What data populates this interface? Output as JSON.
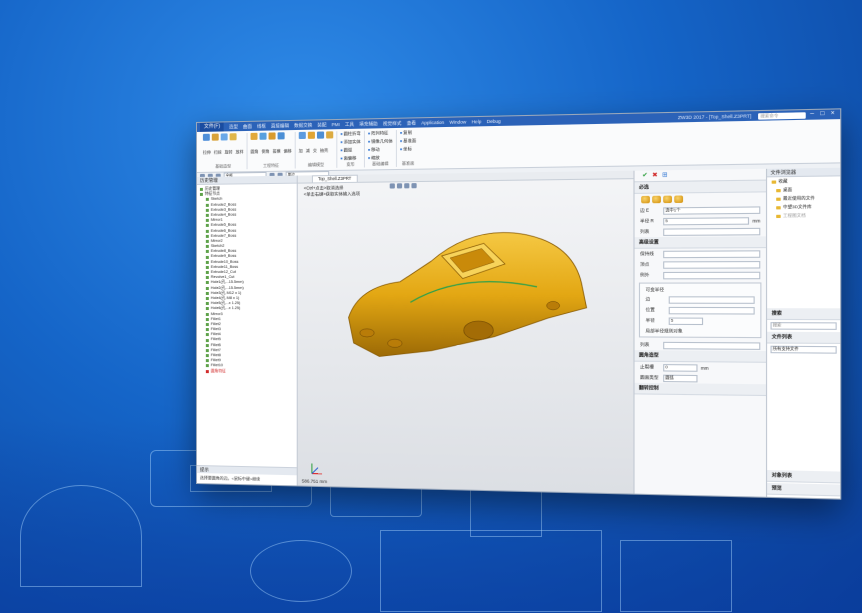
{
  "app": {
    "file_tab": "文件(F)",
    "menus": [
      "造型",
      "曲面",
      "线框",
      "直接编辑",
      "数据交换",
      "装配",
      "PMI",
      "工具",
      "填充辅助",
      "视觉样式",
      "查看",
      "Application",
      "Window",
      "Help",
      "Debug"
    ],
    "title": "ZW3D 2017 - [Top_Shell.Z3PRT]",
    "search_placeholder": "搜索命令",
    "win_buttons": [
      "–",
      "□",
      "×"
    ]
  },
  "ribbon": {
    "groups": [
      {
        "labels": [
          "拉伸",
          "扫掠",
          "旋转",
          "放样"
        ],
        "caption": "基础造型"
      },
      {
        "labels": [
          "圆角",
          "倒角",
          "拔模",
          "偏移"
        ],
        "caption": "工程特征"
      },
      {
        "labels": [
          "加",
          "减",
          "交",
          "抽壳"
        ],
        "caption": "编辑模型"
      },
      {
        "rows": [
          "圆柱折弯",
          "添加实体",
          "圆弧",
          "面偏移"
        ],
        "caption": "变形"
      },
      {
        "rows": [
          "阵列特征",
          "镜像几何体",
          "移动",
          "缩放"
        ],
        "caption": "基础编辑"
      },
      {
        "rows": [
          "复制",
          "基准面",
          "坐标"
        ],
        "caption": "基准面"
      }
    ]
  },
  "toolbar2": {
    "filter_label": "全部",
    "select_label": "单边"
  },
  "left_panel": {
    "title": "历史管理",
    "tree": [
      "历史管理",
      "特征节点",
      "Sketch",
      "Extrude2_Boss",
      "Extrude3_Boss",
      "Extrude4_Boss",
      "Mirror1",
      "Extrude5_Boss",
      "Extrude6_Boss",
      "Extrude7_Boss",
      "Mirror2",
      "Sketch2",
      "Extrude8_Boss",
      "Extrude9_Boss",
      "Extrude10_Boss",
      "Extrude11_Boss",
      "Extrude12_Cut",
      "Revolve1_Cut",
      "Hole1(孔...15.5mm)",
      "Hole2(孔...15.5mm)",
      "Hole3(孔 M12 x 1)",
      "Hole4(孔 M8 x 1)",
      "Hole5(孔...x 1.25)",
      "Hole6(孔...x 1.25)",
      "Mirror3",
      "Fillet1",
      "Fillet2",
      "Fillet3",
      "Fillet4",
      "Fillet5",
      "Fillet6",
      "Fillet7",
      "Fillet8",
      "Fillet9",
      "Fillet10"
    ],
    "red_item": "圆角特征",
    "bottom_title": "提示",
    "bottom_text": "选择要圆角的边。<鼠标中键>继续"
  },
  "viewport": {
    "tab": "Top_Shell.Z3PRT",
    "msg1": "<Ctrl+点击>取消选择",
    "msg2": "<单击右键>获取实体输入选项",
    "status": "586.751 mm"
  },
  "param_panel": {
    "required": "必选",
    "edge_label": "边 E",
    "edge_value": "选中1个",
    "radius_label": "半径 R",
    "radius_value": "5",
    "radius_unit": "mm",
    "list_label": "列表",
    "advanced": "高级设置",
    "keep_line": "保持线",
    "vertex": "顶点",
    "exclude": "例外",
    "var_radius": "可变半径",
    "edge2": "边",
    "position": "位置",
    "radius2": "半径",
    "radius2_value": "5",
    "local_var": "局部半径规则对象",
    "list2": "列表",
    "corner": "圆角造型",
    "stop_label": "止裂槽",
    "stop_value": "0",
    "stop_unit": "mm",
    "corner_type": "圆面类型",
    "corner_type_value": "圆弧",
    "overflow": "翻转控制"
  },
  "right_panel": {
    "title": "文件浏览器",
    "items": [
      "收藏",
      "桌面",
      "最近使用的文件",
      "中望3D文件库",
      "工程图文档"
    ],
    "search_title": "搜索",
    "search_placeholder": "搜索",
    "filelist_title": "文件列表",
    "filter": "所有支持文件",
    "obj_list": "对象列表",
    "preview": "预览"
  }
}
